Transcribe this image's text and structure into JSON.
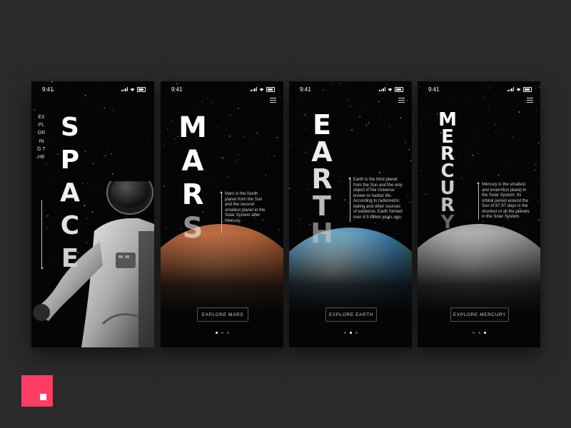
{
  "screens": [
    {
      "time": "9:41",
      "title": "SPACE",
      "subtitle": "EXPLORING THE"
    },
    {
      "time": "9:41",
      "title": "MARS",
      "description": "Mars is the fourth planet from the Sun and the second smallest planet in the Solar System after Mercury.",
      "button_label": "EXPLORE MARS",
      "active_page": 1
    },
    {
      "time": "9:41",
      "title": "EARTH",
      "description": "Earth is the third planet from the Sun and the only object in the Universe known to harbor life. According to radiometric dating and other sources of evidence, Earth formed over 4.5 billion years ago.",
      "button_label": "EXPLORE EARTH",
      "active_page": 2
    },
    {
      "time": "9:41",
      "title": "MERCURY",
      "description": "Mercury is the smallest and innermost planet in the Solar System. Its orbital period around the Sun of 87.97 days is the shortest of all the planets in the Solar System.",
      "button_label": "EXPLORE MERCURY",
      "active_page": 3
    }
  ],
  "icons": [
    "signal-icon",
    "wifi-icon",
    "battery-icon",
    "menu-icon",
    "arrow-up-icon",
    "arrow-down-icon"
  ],
  "colors": {
    "background": "#2a2a2a",
    "screen": "#050505",
    "brand": "#ff3c66",
    "mars": "#b5653c",
    "earth": "#3a78a8",
    "mercury": "#8c8c8c"
  }
}
